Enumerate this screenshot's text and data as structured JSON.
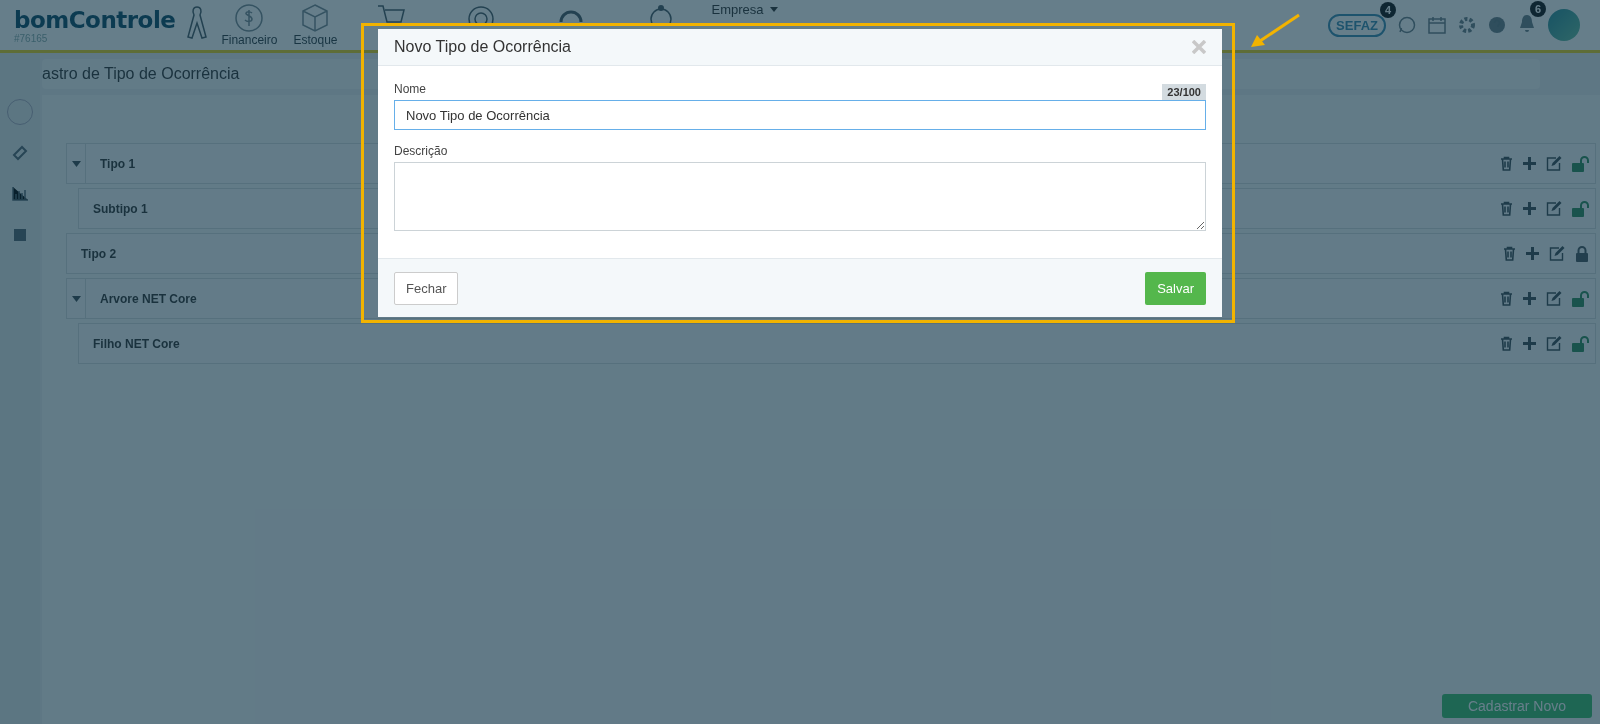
{
  "header": {
    "logo": "bomControle",
    "account": "#76165",
    "nav": [
      {
        "label": "Financeiro"
      },
      {
        "label": "Estoque"
      }
    ],
    "company_menu": "Empresa",
    "sefaz": {
      "label": "SEFAZ",
      "badge": "4"
    },
    "notifications_badge": "6"
  },
  "page": {
    "title": "astro de Tipo de Ocorrência"
  },
  "tree": [
    {
      "label": "Tipo 1",
      "expanded": true,
      "locked": false,
      "children": [
        {
          "label": "Subtipo 1",
          "locked": false
        }
      ]
    },
    {
      "label": "Tipo 2",
      "locked": true
    },
    {
      "label": "Arvore NET Core",
      "expanded": true,
      "locked": false,
      "children": [
        {
          "label": "Filho NET Core",
          "locked": false
        }
      ]
    }
  ],
  "footer": {
    "button": "Cadastrar Novo"
  },
  "modal": {
    "title": "Novo Tipo de Ocorrência",
    "name_label": "Nome",
    "counter": "23/100",
    "name_value": "Novo Tipo de Ocorrência",
    "description_label": "Descrição",
    "close_button": "Fechar",
    "save_button": "Salvar"
  }
}
